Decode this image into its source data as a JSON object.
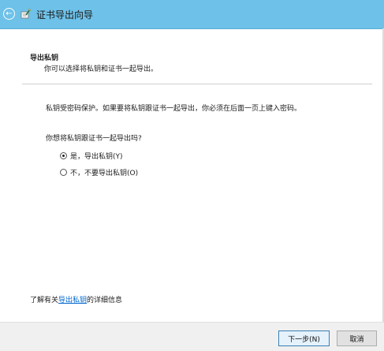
{
  "window": {
    "title": "证书导出向导",
    "back_glyph": "←"
  },
  "header": {
    "heading": "导出私钥",
    "subheading": "你可以选择将私钥和证书一起导出。"
  },
  "main": {
    "info": "私钥受密码保护。如果要将私钥跟证书一起导出，你必须在后面一页上键入密码。",
    "question": "你想将私钥跟证书一起导出吗?",
    "options": [
      {
        "label": "是，导出私钥(Y)",
        "selected": true
      },
      {
        "label": "不，不要导出私钥(O)",
        "selected": false
      }
    ]
  },
  "learn_more": {
    "prefix": "了解有关",
    "link": "导出私钥",
    "suffix": "的详细信息"
  },
  "footer": {
    "next_label": "下一步(N)",
    "cancel_label": "取消"
  },
  "colors": {
    "titlebar": "#6ec1e8",
    "link": "#0066cc"
  }
}
